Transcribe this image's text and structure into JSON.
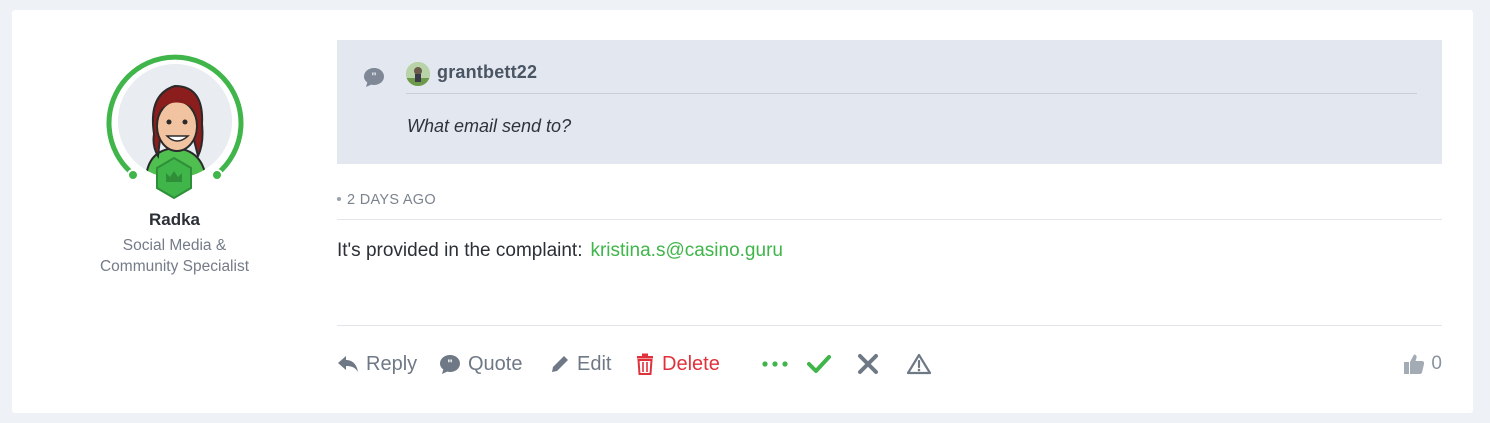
{
  "author": {
    "name": "Radka",
    "role_line1": "Social Media &",
    "role_line2": "Community Specialist",
    "ring_color": "#3fb54a"
  },
  "quote": {
    "username": "grantbett22",
    "text": "What email send to?"
  },
  "post": {
    "timestamp": "2 DAYS AGO",
    "body_text": "It's provided in the complaint:",
    "email_link": "kristina.s@casino.guru"
  },
  "actions": {
    "reply_label": "Reply",
    "quote_label": "Quote",
    "edit_label": "Edit",
    "delete_label": "Delete",
    "more_icon": "ellipsis-icon",
    "approve_icon": "check-icon",
    "reject_icon": "x-icon",
    "report_icon": "warning-icon",
    "like_count": "0"
  },
  "colors": {
    "accent_green": "#3fb54a",
    "delete_red": "#e0323c",
    "muted": "#6f7986"
  }
}
